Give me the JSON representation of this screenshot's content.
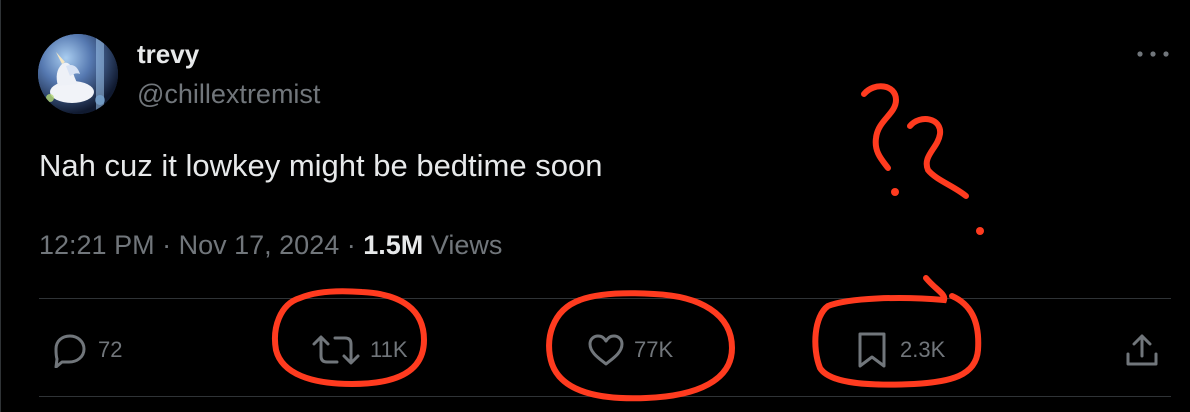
{
  "author": {
    "display_name": "trevy",
    "handle": "@chillextremist"
  },
  "tweet": {
    "text": "Nah cuz it lowkey might be bedtime soon",
    "time": "12:21 PM",
    "separator": "·",
    "date": "Nov 17, 2024",
    "views_count": "1.5M",
    "views_label": "Views"
  },
  "actions": {
    "reply_count": "72",
    "retweet_count": "11K",
    "like_count": "77K",
    "bookmark_count": "2.3K"
  },
  "colors": {
    "background": "#000000",
    "primary_text": "#e7e9ea",
    "secondary_text": "#71767b",
    "divider": "#2f3336",
    "annotation": "#ff3b1f"
  },
  "icons": [
    "more-icon",
    "reply-icon",
    "retweet-icon",
    "like-icon",
    "bookmark-icon",
    "share-icon"
  ]
}
